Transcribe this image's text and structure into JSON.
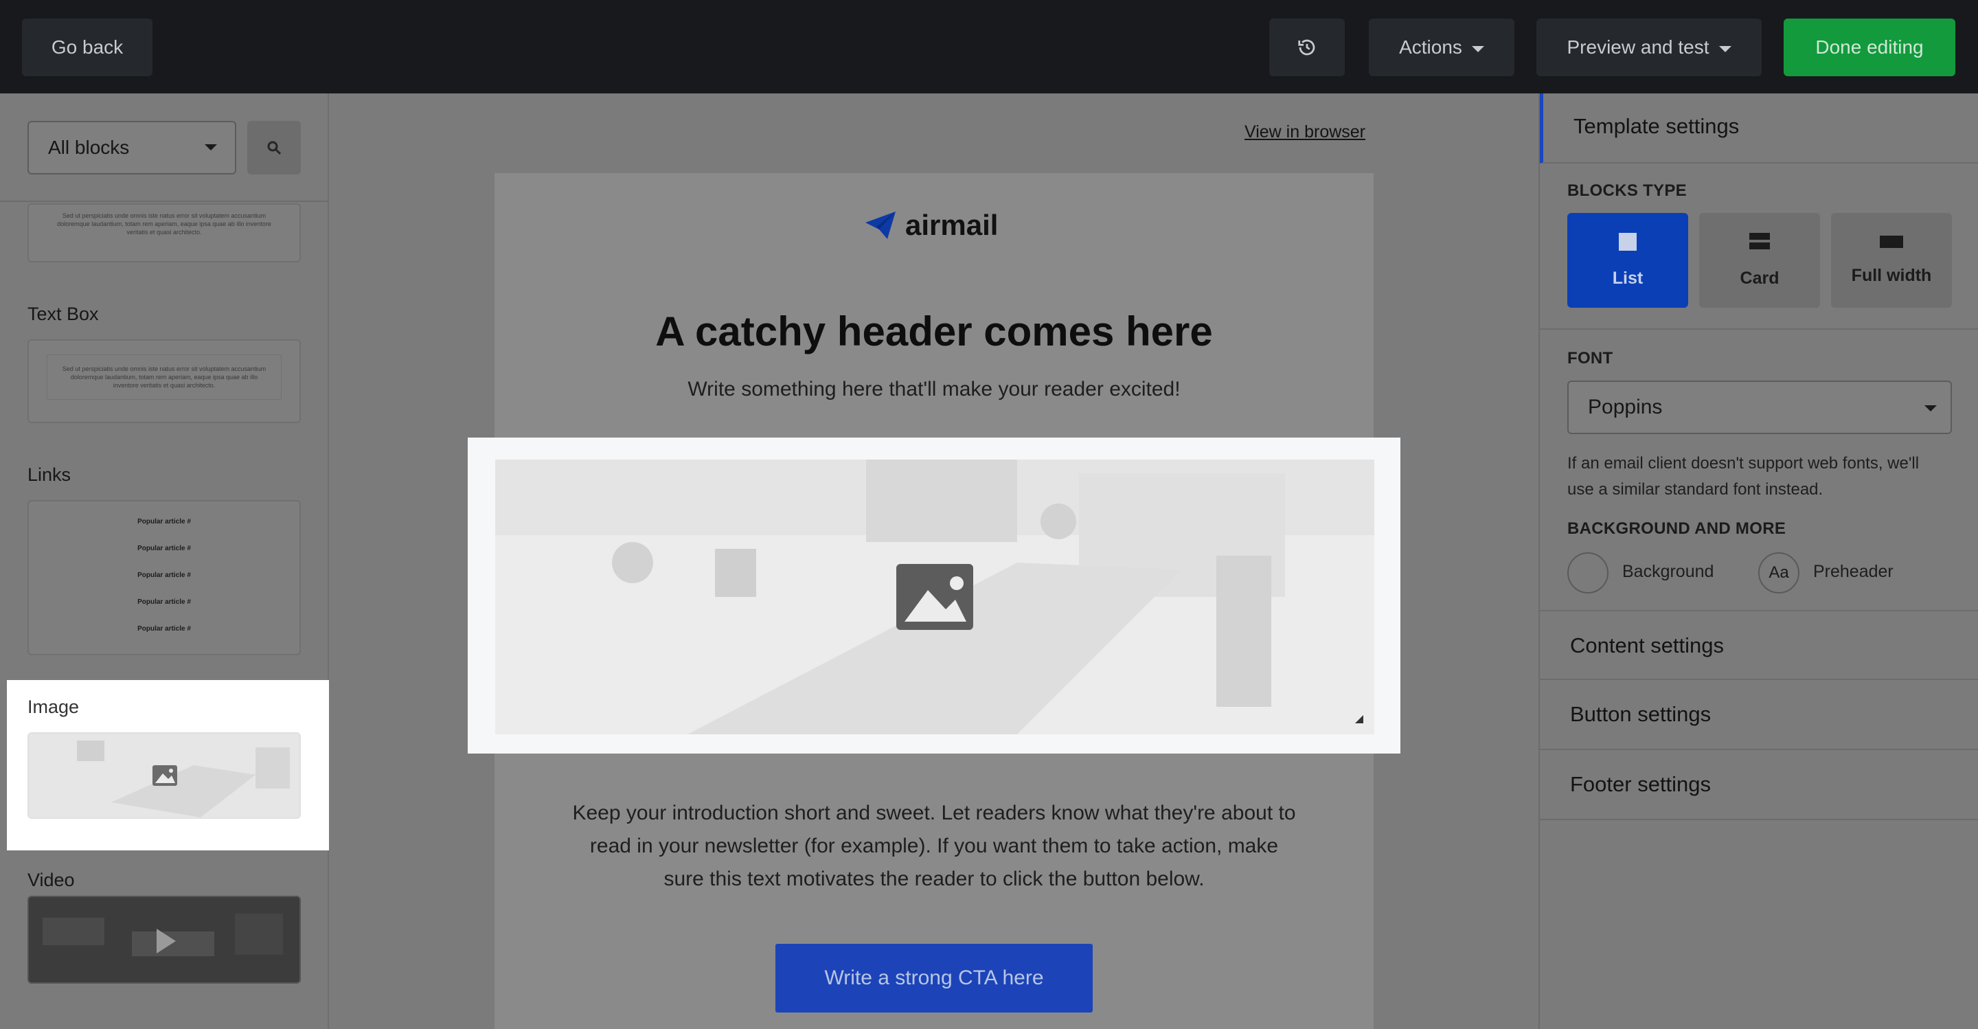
{
  "topbar": {
    "go_back": "Go back",
    "actions": "Actions",
    "preview": "Preview and test",
    "done": "Done editing"
  },
  "sidebar": {
    "filter_value": "All blocks",
    "lorem_1": "Sed ut perspiciatis unde omnis iste natus error sit voluptatem accusantium doloremque laudantium, totam rem aperiam, eaque ipsa quae ab illo inventore veritatis et quasi architecto.",
    "lorem_2": "Sed ut perspiciatis unde omnis iste natus error sit voluptatem accusantium doloremque laudantium, totam rem aperiam, eaque ipsa quae ab illo inventore veritatis et quasi architecto.",
    "textbox_label": "Text Box",
    "links_label": "Links",
    "links": [
      "Popular article #",
      "Popular article #",
      "Popular article #",
      "Popular article #",
      "Popular article #"
    ],
    "image_label": "Image",
    "video_label": "Video"
  },
  "canvas": {
    "view_in_browser": "View in browser",
    "logo_text": "airmail",
    "header": "A catchy header comes here",
    "subheader": "Write something here that'll make your reader excited!",
    "intro_line1": "Keep your introduction short and sweet. Let readers know what they're about to",
    "intro_line2": "read in your newsletter (for example). If you want them to take action, make",
    "intro_line3": "sure this text motivates the reader to click the button below.",
    "cta": "Write a strong CTA here"
  },
  "panel": {
    "template_settings": "Template settings",
    "blocks_type_caption": "BLOCKS TYPE",
    "block_types": [
      "List",
      "Card",
      "Full width"
    ],
    "font_caption": "FONT",
    "font_value": "Poppins",
    "font_note_1": "If an email client doesn't support web fonts, we'll",
    "font_note_2": "use a similar standard font instead.",
    "bg_caption": "BACKGROUND AND MORE",
    "background": "Background",
    "preheader_icon": "Aa",
    "preheader": "Preheader",
    "content_settings": "Content settings",
    "button_settings": "Button settings",
    "footer_settings": "Footer settings"
  },
  "colors": {
    "topbar": "#17191c",
    "done_button": "#139a3d",
    "active_block": "#0b3fb6",
    "cta": "#1c44b8"
  }
}
